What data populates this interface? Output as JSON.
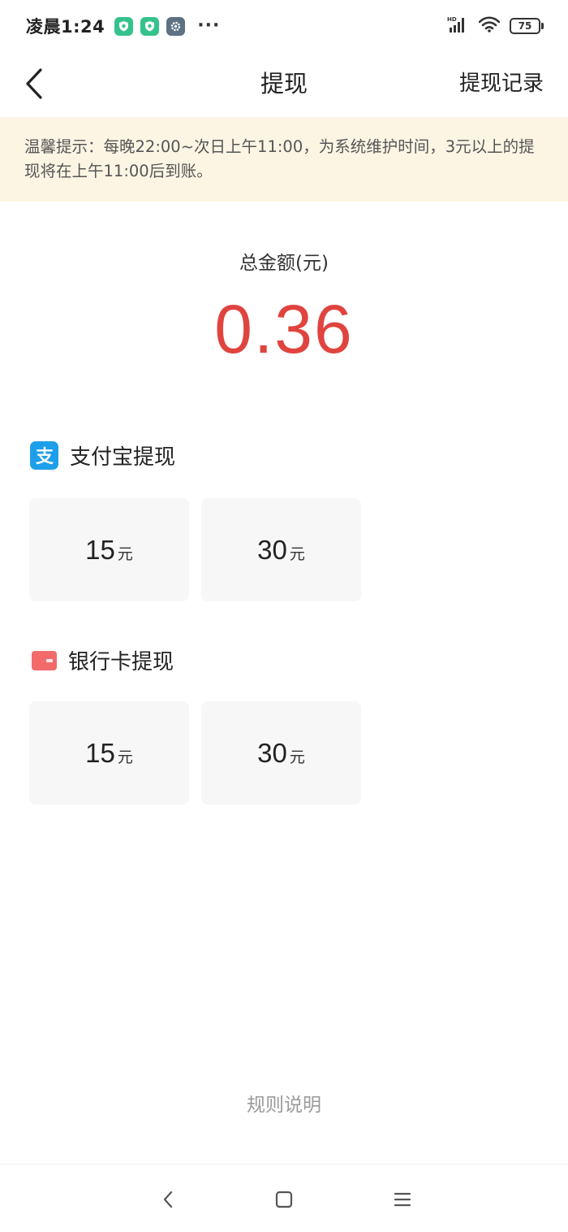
{
  "status_bar": {
    "time": "凌晨1:24",
    "more": "···",
    "network": "HD",
    "battery": "75"
  },
  "header": {
    "title": "提现",
    "records_link": "提现记录"
  },
  "notice": {
    "text": "温馨提示：每晚22:00~次日上午11:00，为系统维护时间，3元以上的提现将在上午11:00后到账。"
  },
  "balance": {
    "label": "总金额(元)",
    "amount": "0.36",
    "amount_color": "#e0443f"
  },
  "alipay": {
    "title": "支付宝提现",
    "icon": "alipay-icon",
    "icon_glyph": "支",
    "options": [
      {
        "amount": "15",
        "unit": "元"
      },
      {
        "amount": "30",
        "unit": "元"
      }
    ]
  },
  "bank": {
    "title": "银行卡提现",
    "icon": "bank-card-icon",
    "options": [
      {
        "amount": "15",
        "unit": "元"
      },
      {
        "amount": "30",
        "unit": "元"
      }
    ]
  },
  "footer": {
    "rules_link": "规则说明"
  },
  "system_nav": {
    "icons": [
      "back-icon",
      "home-icon",
      "menu-icon"
    ]
  }
}
